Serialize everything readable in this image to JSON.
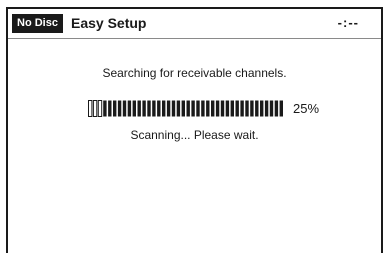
{
  "header": {
    "disc_status": "No Disc",
    "title": "Easy Setup",
    "time": "-:--"
  },
  "scan": {
    "message": "Searching for receivable channels.",
    "progress_fraction": 0.25,
    "percent_label": "25%",
    "status": "Scanning... Please wait."
  },
  "colors": {
    "ink": "#1a1a1a",
    "background": "#ffffff"
  }
}
